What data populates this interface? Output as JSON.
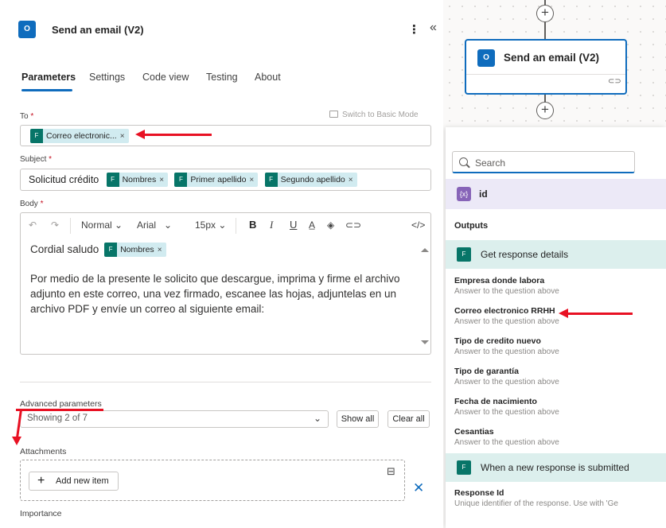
{
  "header": {
    "title": "Send an email (V2)",
    "app_icon": "outlook-icon"
  },
  "tabs": [
    {
      "label": "Parameters",
      "active": true
    },
    {
      "label": "Settings"
    },
    {
      "label": "Code view"
    },
    {
      "label": "Testing"
    },
    {
      "label": "About"
    }
  ],
  "to": {
    "label": "To",
    "required": "*",
    "switch_label": "Switch to Basic Mode",
    "token": "Correo electronic..."
  },
  "subject": {
    "label": "Subject",
    "required": "*",
    "text": "Solicitud crédito",
    "tokens": [
      "Nombres",
      "Primer apellido",
      "Segundo apellido"
    ]
  },
  "body": {
    "label": "Body",
    "required": "*",
    "toolbar": {
      "style": "Normal",
      "font": "Arial",
      "size": "15px",
      "bold": "B",
      "italic": "I",
      "underline": "U",
      "code": "</>"
    },
    "greeting": "Cordial saludo",
    "greeting_token": "Nombres",
    "paragraph": "Por medio de la presente le solicito que descargue, imprima y firme el archivo adjunto en este correo, una vez firmado, escanee las hojas, adjuntelas en un archivo PDF y envíe un correo al siguiente email:"
  },
  "advanced": {
    "label": "Advanced parameters",
    "showing": "Showing 2 of 7",
    "show_all": "Show all",
    "clear_all": "Clear all"
  },
  "attachments": {
    "label": "Attachments",
    "add_item": "Add new item"
  },
  "importance": {
    "label": "Importance"
  },
  "canvas": {
    "node_title": "Send an email (V2)"
  },
  "dynamic": {
    "search_placeholder": "Search",
    "id_label": "id",
    "outputs_label": "Outputs",
    "group1": "Get response details",
    "items": [
      {
        "title": "Empresa donde labora",
        "desc": "Answer to the question above"
      },
      {
        "title": "Correo electronico RRHH",
        "desc": "Answer to the question above"
      },
      {
        "title": "Tipo de credito nuevo",
        "desc": "Answer to the question above"
      },
      {
        "title": "Tipo de garantía",
        "desc": "Answer to the question above"
      },
      {
        "title": "Fecha de nacimiento",
        "desc": "Answer to the question above"
      },
      {
        "title": "Cesantias",
        "desc": "Answer to the question above"
      }
    ],
    "group2": "When a new response is submitted",
    "response_item": {
      "title": "Response Id",
      "desc": "Unique identifier of the response. Use with 'Ge"
    }
  },
  "colors": {
    "accent": "#0f6cbd",
    "token_bg": "#d1ebf0",
    "forms_green": "#077568",
    "annotation_red": "#e81123"
  }
}
